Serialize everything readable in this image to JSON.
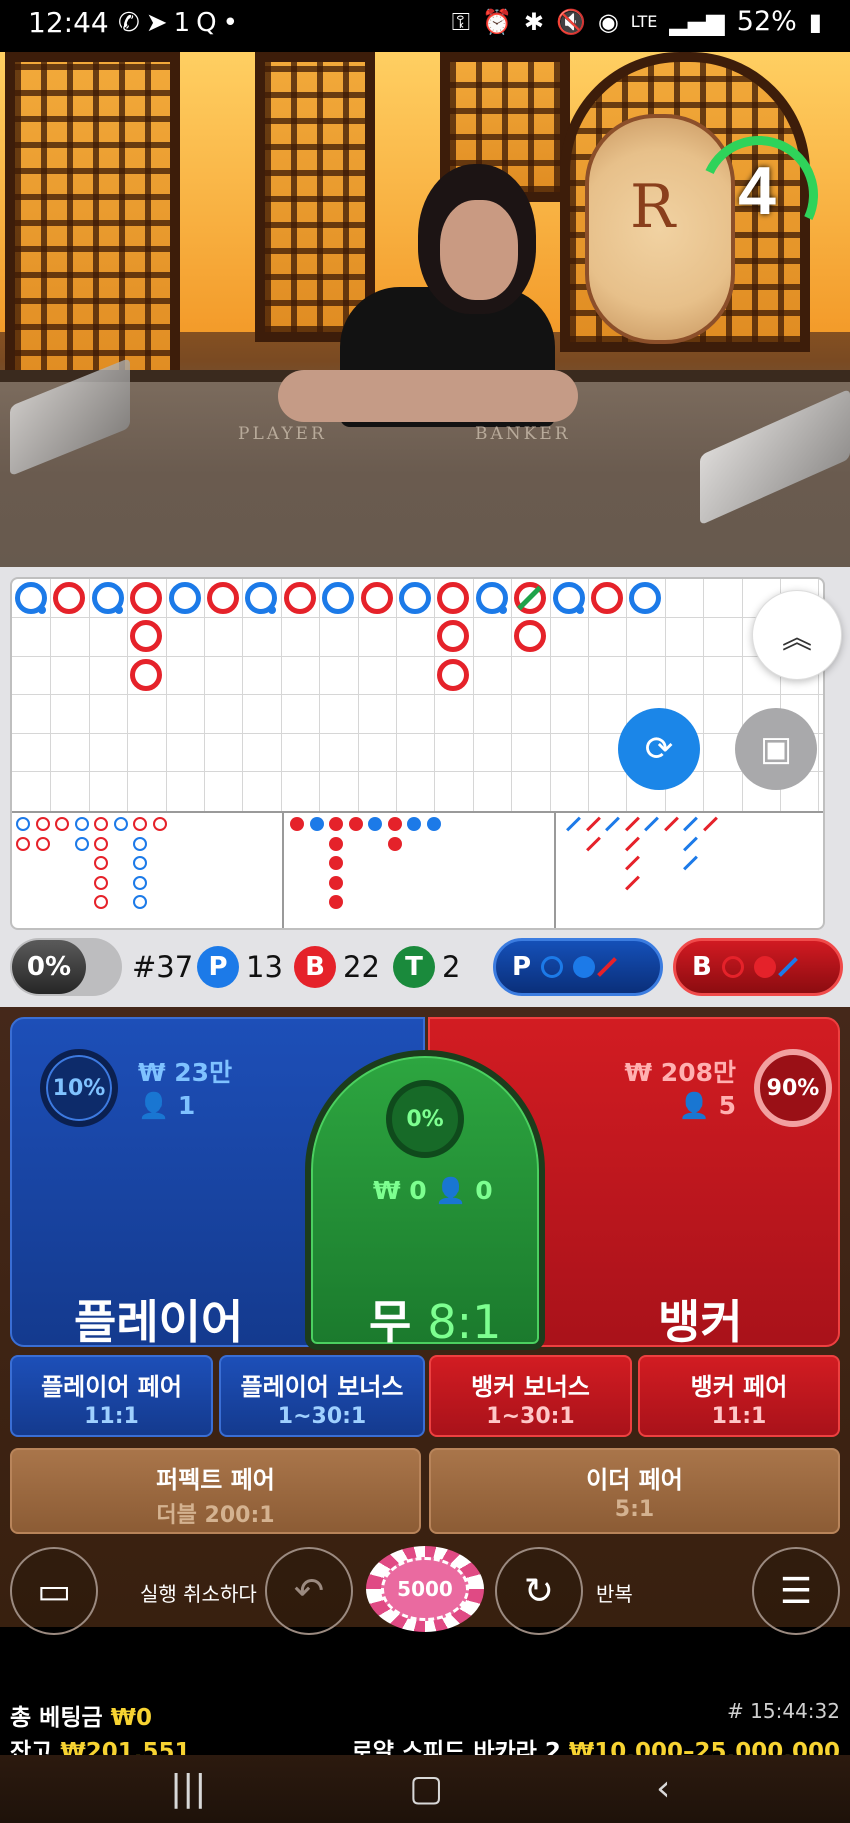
{
  "status_bar": {
    "time": "12:44",
    "left_icons": [
      "volte-icon",
      "telegram-icon",
      "1q-icon",
      "dot-icon"
    ],
    "right_icons": [
      "key-icon",
      "alarm-icon",
      "bluetooth-icon",
      "mute-icon",
      "hotspot-icon",
      "lte-icon",
      "signal-icon",
      "battery-icon"
    ],
    "battery": "52%"
  },
  "video": {
    "countdown": "4",
    "table_left_label": "PLAYER",
    "table_right_label": "BANKER",
    "logo_letter": "R"
  },
  "stats": {
    "percent": "0%",
    "round": "#37",
    "player_letter": "P",
    "player_count": "13",
    "banker_letter": "B",
    "banker_count": "22",
    "tie_letter": "T",
    "tie_count": "2",
    "predict_player": "P",
    "predict_banker": "B"
  },
  "bets": {
    "player": {
      "label": "플레이어",
      "amount": "₩ 23만",
      "users": "1",
      "percent": "10%"
    },
    "tie": {
      "label": "무",
      "odds": "8:1",
      "amount": "₩ 0",
      "users": "0",
      "percent": "0%"
    },
    "banker": {
      "label": "뱅커",
      "amount": "₩ 208만",
      "users": "5",
      "percent": "90%"
    },
    "side": [
      {
        "title": "플레이어 페어",
        "odds": "11:1"
      },
      {
        "title": "플레이어 보너스",
        "odds": "1~30:1"
      },
      {
        "title": "뱅커 보너스",
        "odds": "1~30:1"
      },
      {
        "title": "뱅커 페어",
        "odds": "11:1"
      },
      {
        "title": "퍼펙트 페어",
        "odds": "더블 200:1"
      },
      {
        "title": "이더 페어",
        "odds": "5:1"
      }
    ]
  },
  "controls": {
    "undo_label": "실행 취소하다",
    "repeat_label": "반복",
    "chip_value": "5000"
  },
  "footer": {
    "total_bet_label": "총 베팅금",
    "total_bet_value": "₩0",
    "balance_label": "잔고",
    "balance_value": "₩201,551",
    "time": "# 15:44:32",
    "table_name": "로얄 스피드 바카라 2",
    "limits": "₩10,000–25,000,000"
  },
  "colors": {
    "player_blue": "#1d4fb8",
    "banker_red": "#d21c22",
    "tie_green": "#2da640",
    "accent_yellow": "#f7d332",
    "road_blue": "#1c7ae8",
    "road_red": "#e5222a"
  }
}
